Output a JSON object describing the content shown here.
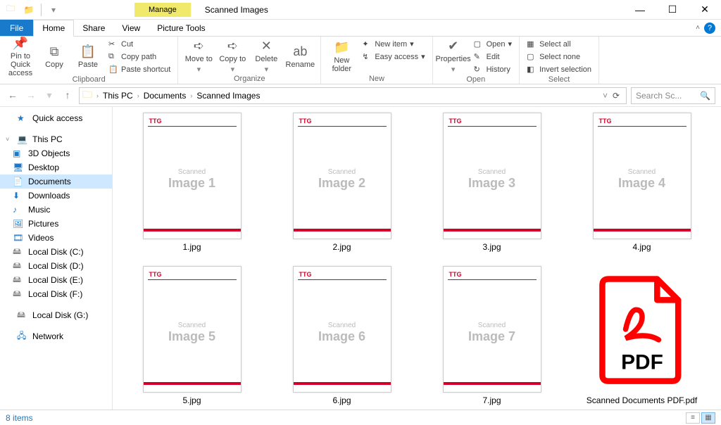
{
  "window": {
    "context_tab": "Manage",
    "context_sub": "Picture Tools",
    "title": "Scanned Images"
  },
  "ribbon_tabs": {
    "file": "File",
    "home": "Home",
    "share": "Share",
    "view": "View"
  },
  "ribbon": {
    "clipboard": {
      "label": "Clipboard",
      "pin": "Pin to Quick access",
      "copy": "Copy",
      "paste": "Paste",
      "cut": "Cut",
      "copy_path": "Copy path",
      "paste_shortcut": "Paste shortcut"
    },
    "organize": {
      "label": "Organize",
      "move_to": "Move to",
      "copy_to": "Copy to",
      "delete": "Delete",
      "rename": "Rename"
    },
    "new": {
      "label": "New",
      "new_folder": "New folder",
      "new_item": "New item",
      "easy_access": "Easy access"
    },
    "open": {
      "label": "Open",
      "properties": "Properties",
      "open": "Open",
      "edit": "Edit",
      "history": "History"
    },
    "select": {
      "label": "Select",
      "select_all": "Select all",
      "select_none": "Select none",
      "invert": "Invert selection"
    }
  },
  "breadcrumb": {
    "items": [
      "This PC",
      "Documents",
      "Scanned Images"
    ]
  },
  "search": {
    "placeholder": "Search Sc..."
  },
  "sidebar": {
    "quick_access": "Quick access",
    "this_pc": "This PC",
    "children": [
      "3D Objects",
      "Desktop",
      "Documents",
      "Downloads",
      "Music",
      "Pictures",
      "Videos",
      "Local Disk (C:)",
      "Local Disk (D:)",
      "Local Disk (E:)",
      "Local Disk (F:)"
    ],
    "local_g": "Local Disk (G:)",
    "network": "Network"
  },
  "files": [
    {
      "name": "1.jpg",
      "thumb_small": "Scanned",
      "thumb_big": "Image 1",
      "brand": "TTG"
    },
    {
      "name": "2.jpg",
      "thumb_small": "Scanned",
      "thumb_big": "Image 2",
      "brand": "TTG"
    },
    {
      "name": "3.jpg",
      "thumb_small": "Scanned",
      "thumb_big": "Image 3",
      "brand": "TTG"
    },
    {
      "name": "4.jpg",
      "thumb_small": "Scanned",
      "thumb_big": "Image 4",
      "brand": "TTG"
    },
    {
      "name": "5.jpg",
      "thumb_small": "Scanned",
      "thumb_big": "Image 5",
      "brand": "TTG"
    },
    {
      "name": "6.jpg",
      "thumb_small": "Scanned",
      "thumb_big": "Image 6",
      "brand": "TTG"
    },
    {
      "name": "7.jpg",
      "thumb_small": "Scanned",
      "thumb_big": "Image 7",
      "brand": "TTG"
    }
  ],
  "pdf_file": {
    "name": "Scanned Documents PDF.pdf",
    "badge": "PDF"
  },
  "status": {
    "count": "8 items"
  }
}
